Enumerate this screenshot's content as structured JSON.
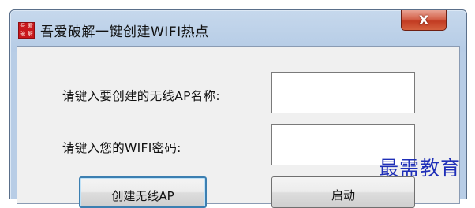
{
  "window": {
    "title": "吾爱破解一键创建WIFI热点",
    "icon_text": [
      "吾",
      "爱",
      "破",
      "解"
    ],
    "close_glyph": "X"
  },
  "form": {
    "ap_name_label": "请键入要创建的无线AP名称:",
    "ap_name_value": "",
    "password_label": "请键入您的WIFI密码:",
    "password_value": ""
  },
  "buttons": {
    "create_label": "创建无线AP",
    "start_label": "启动"
  },
  "watermark": "最需教育",
  "colors": {
    "close_button": "#c23b22",
    "watermark": "#1f2fb8",
    "title_bar": "#b8cde6"
  }
}
